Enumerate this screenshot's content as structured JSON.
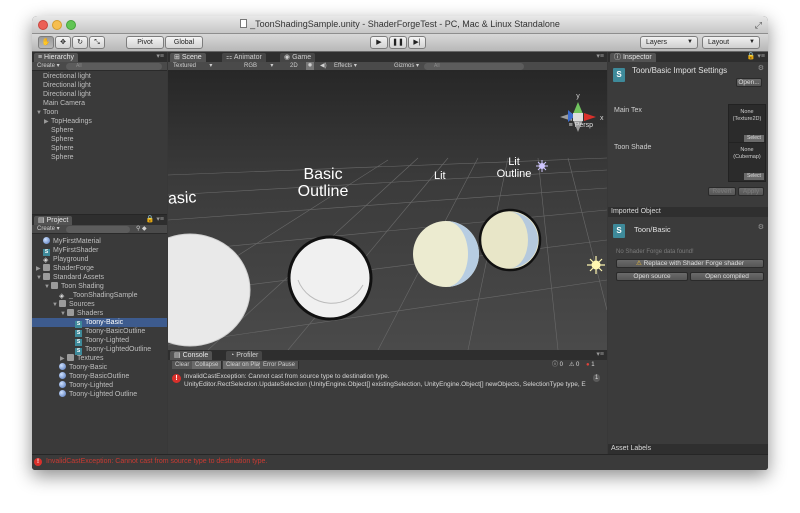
{
  "window": {
    "title": "_ToonShadingSample.unity - ShaderForgeTest - PC, Mac & Linux Standalone"
  },
  "toolbar": {
    "pivot_label": "Pivot",
    "global_label": "Global",
    "layers_label": "Layers",
    "layout_label": "Layout"
  },
  "hierarchy": {
    "tab_label": "Hierarchy",
    "create_label": "Create",
    "search_placeholder": "All",
    "items": [
      {
        "label": "Directional light",
        "indent": 0,
        "arrow": ""
      },
      {
        "label": "Directional light",
        "indent": 0,
        "arrow": ""
      },
      {
        "label": "Directional light",
        "indent": 0,
        "arrow": ""
      },
      {
        "label": "Main Camera",
        "indent": 0,
        "arrow": ""
      },
      {
        "label": "Toon",
        "indent": 0,
        "arrow": "▼"
      },
      {
        "label": "TopHeadings",
        "indent": 1,
        "arrow": "▶"
      },
      {
        "label": "Sphere",
        "indent": 1,
        "arrow": ""
      },
      {
        "label": "Sphere",
        "indent": 1,
        "arrow": ""
      },
      {
        "label": "Sphere",
        "indent": 1,
        "arrow": ""
      },
      {
        "label": "Sphere",
        "indent": 1,
        "arrow": ""
      }
    ]
  },
  "project": {
    "tab_label": "Project",
    "create_label": "Create",
    "items": [
      {
        "label": "MyFirstMaterial",
        "indent": 0,
        "arrow": "",
        "icon": "material"
      },
      {
        "label": "MyFirstShader",
        "indent": 0,
        "arrow": "",
        "icon": "shader"
      },
      {
        "label": "Playground",
        "indent": 0,
        "arrow": "",
        "icon": "scene"
      },
      {
        "label": "ShaderForge",
        "indent": 0,
        "arrow": "▶",
        "icon": "folder"
      },
      {
        "label": "Standard Assets",
        "indent": 0,
        "arrow": "▼",
        "icon": "folder"
      },
      {
        "label": "Toon Shading",
        "indent": 1,
        "arrow": "▼",
        "icon": "folder"
      },
      {
        "label": "_ToonShadingSample",
        "indent": 2,
        "arrow": "",
        "icon": "scene"
      },
      {
        "label": "Sources",
        "indent": 2,
        "arrow": "▼",
        "icon": "folder"
      },
      {
        "label": "Shaders",
        "indent": 3,
        "arrow": "▼",
        "icon": "folder"
      },
      {
        "label": "Toony-Basic",
        "indent": 4,
        "arrow": "",
        "icon": "shader",
        "selected": true
      },
      {
        "label": "Toony-BasicOutline",
        "indent": 4,
        "arrow": "",
        "icon": "shader"
      },
      {
        "label": "Toony-Lighted",
        "indent": 4,
        "arrow": "",
        "icon": "shader"
      },
      {
        "label": "Toony-LightedOutline",
        "indent": 4,
        "arrow": "",
        "icon": "shader"
      },
      {
        "label": "Textures",
        "indent": 3,
        "arrow": "▶",
        "icon": "folder"
      },
      {
        "label": "Toony-Basic",
        "indent": 2,
        "arrow": "",
        "icon": "material"
      },
      {
        "label": "Toony-BasicOutline",
        "indent": 2,
        "arrow": "",
        "icon": "material"
      },
      {
        "label": "Toony-Lighted",
        "indent": 2,
        "arrow": "",
        "icon": "material"
      },
      {
        "label": "Toony-Lighted Outline",
        "indent": 2,
        "arrow": "",
        "icon": "material"
      }
    ]
  },
  "scene": {
    "tabs": [
      "Scene",
      "Animator",
      "Game"
    ],
    "shading_mode": "Textured",
    "render_mode": "RGB",
    "mode_2d": "2D",
    "effects_label": "Effects",
    "gizmos_label": "Gizmos",
    "search_placeholder": "All",
    "labels": {
      "basic_left": "asic",
      "basic_outline": "Basic\nOutline",
      "lit": "Lit",
      "lit_outline": "Lit\nOutline"
    },
    "persp_label": "Persp"
  },
  "console": {
    "tabs": [
      "Console",
      "Profiler"
    ],
    "buttons": [
      "Clear",
      "Collapse",
      "Clear on Play",
      "Error Pause"
    ],
    "counts": {
      "log": "0",
      "warn": "0",
      "error": "1"
    },
    "message_line1": "InvalidCastException: Cannot cast from source type to destination type.",
    "message_line2": "UnityEditor.RectSelection.UpdateSelection (UnityEngine.Object[] existingSelection, UnityEngine.Object[] newObjects, SelectionType type, E",
    "repeat_count": "1"
  },
  "inspector": {
    "tab_label": "Inspector",
    "title": "Toon/Basic Import Settings",
    "open_label": "Open...",
    "main_tex_label": "Main Tex",
    "main_tex_value": "None\n(Texture2D)",
    "toon_shade_label": "Toon Shade",
    "toon_shade_value": "None\n(Cubemap)",
    "select_label": "Select",
    "revert_label": "Revert",
    "apply_label": "Apply",
    "imported_object_label": "Imported Object",
    "shader_name": "Toon/Basic",
    "no_sf_data": "No Shader Forge data found!",
    "replace_label": "Replace with Shader Forge shader",
    "open_source_label": "Open source",
    "open_compiled_label": "Open compiled",
    "asset_labels_label": "Asset Labels"
  },
  "status": {
    "message": "InvalidCastException: Cannot cast from source type to destination type."
  },
  "colors": {
    "selection": "#3d5b8e",
    "error": "#d9302b",
    "accent_shader": "#3e8a9a"
  }
}
